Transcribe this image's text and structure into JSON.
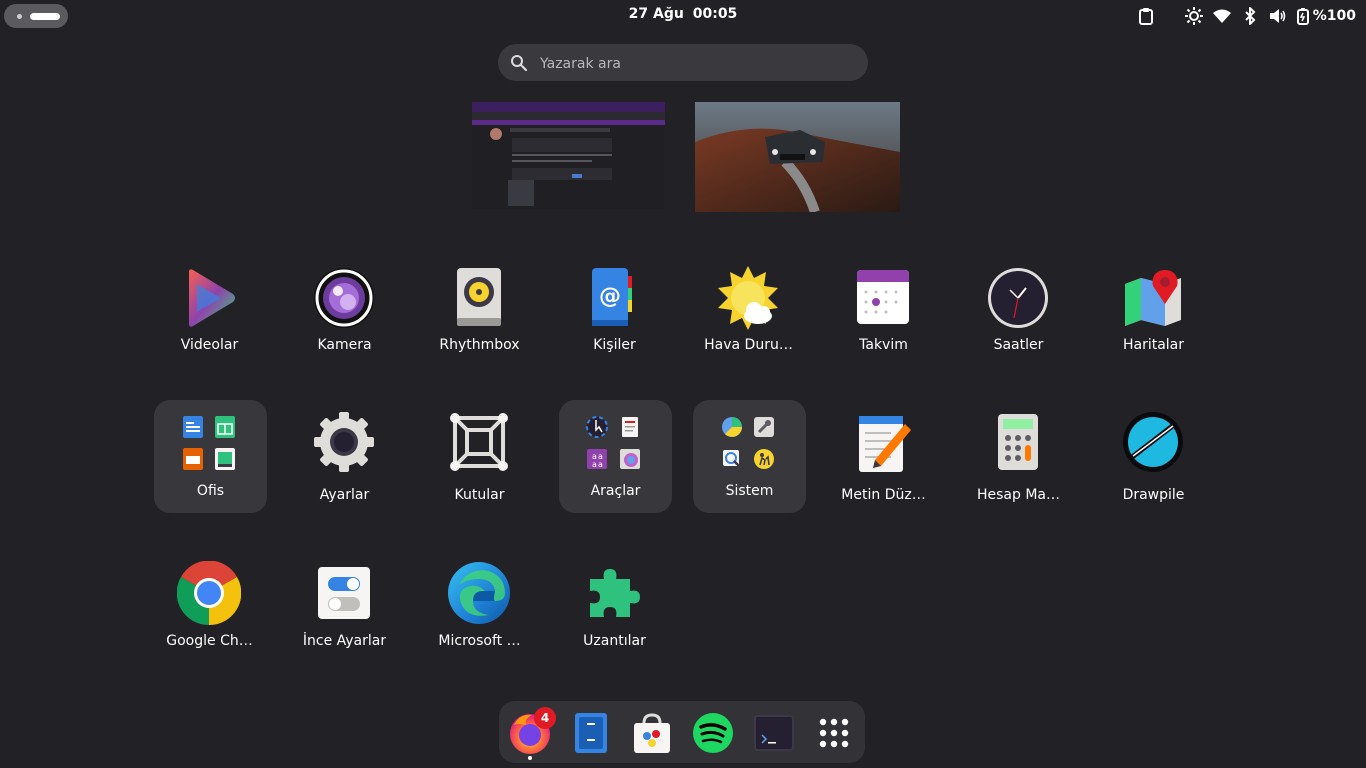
{
  "topbar": {
    "date": "27 Ağu",
    "time": "00:05",
    "battery": "%100",
    "icons": [
      "clipboard-icon",
      "brightness-icon",
      "wifi-icon",
      "bluetooth-icon",
      "volume-icon",
      "battery-icon"
    ]
  },
  "search": {
    "placeholder": "Yazarak ara"
  },
  "apps": [
    {
      "label": "Videolar"
    },
    {
      "label": "Kamera"
    },
    {
      "label": "Rhythmbox"
    },
    {
      "label": "Kişiler"
    },
    {
      "label": "Hava Duru…"
    },
    {
      "label": "Takvim"
    },
    {
      "label": "Saatler"
    },
    {
      "label": "Haritalar"
    },
    {
      "label": "Ofis"
    },
    {
      "label": "Ayarlar"
    },
    {
      "label": "Kutular"
    },
    {
      "label": "Araçlar"
    },
    {
      "label": "Sistem"
    },
    {
      "label": "Metin Düz…"
    },
    {
      "label": "Hesap Ma…"
    },
    {
      "label": "Drawpile"
    },
    {
      "label": "Google Ch…"
    },
    {
      "label": "İnce Ayarlar"
    },
    {
      "label": "Microsoft …"
    },
    {
      "label": "Uzantılar"
    }
  ],
  "dock": {
    "items": [
      "firefox-icon",
      "files-icon",
      "software-icon",
      "spotify-icon",
      "terminal-icon",
      "show-apps-icon"
    ],
    "firefox_badge": "4"
  },
  "colors": {
    "background": "#222226",
    "accent_red": "#e01b24",
    "folder_bg": "#38383c"
  }
}
